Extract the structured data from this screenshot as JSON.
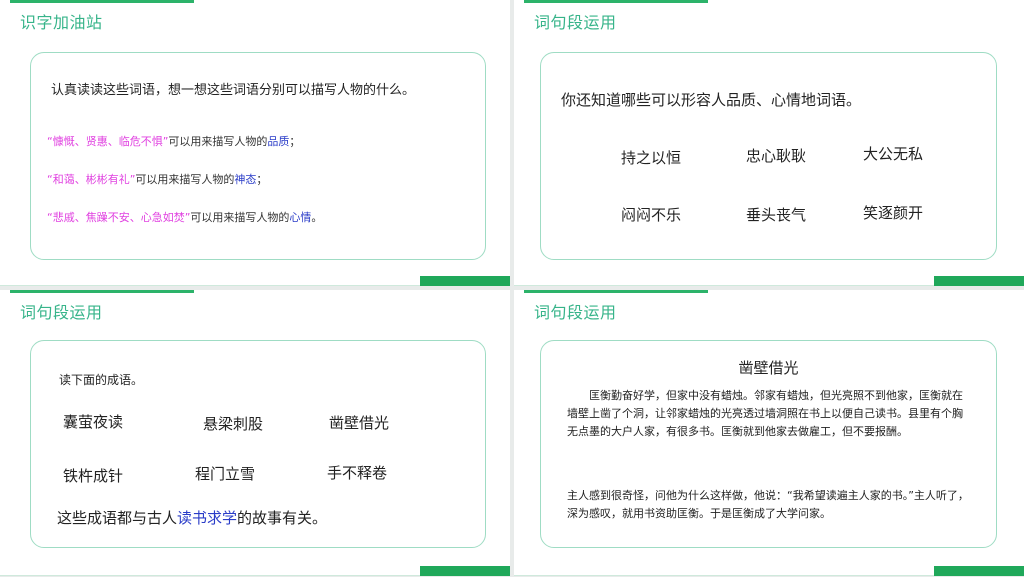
{
  "slide1": {
    "title": "识字加油站",
    "intro": "认真读读这些词语，想一想这些词语分别可以描写人物的什么。",
    "lines": [
      {
        "quote": "“慷慨、贤惠、临危不惧”",
        "mid": "可以用来描写人物的",
        "key": "品质",
        "end": "；"
      },
      {
        "quote": "“和蔼、彬彬有礼”",
        "mid": "可以用来描写人物的",
        "key": "神态",
        "end": "；"
      },
      {
        "quote": "“悲戚、焦躁不安、心急如焚”",
        "mid": "可以用来描写人物的",
        "key": "心情",
        "end": "。"
      }
    ]
  },
  "slide2": {
    "title": "词句段运用",
    "question": "你还知道哪些可以形容人品质、心情地词语。",
    "words": [
      "持之以恒",
      "忠心耿耿",
      "大公无私",
      "闷闷不乐",
      "垂头丧气",
      "笑逐颜开"
    ]
  },
  "slide3": {
    "title": "词句段运用",
    "intro": "读下面的成语。",
    "idioms": [
      "囊萤夜读",
      "悬梁刺股",
      "凿壁借光",
      "铁杵成针",
      "程门立雪",
      "手不释卷"
    ],
    "conclusion_pre": "这些成语都与古人",
    "conclusion_key": "读书求学",
    "conclusion_post": "的故事有关。"
  },
  "slide4": {
    "title": "词句段运用",
    "story_title": "凿壁借光",
    "p1": "匡衡勤奋好学，但家中没有蜡烛。邻家有蜡烛，但光亮照不到他家，匡衡就在墙壁上凿了个洞，让邻家蜡烛的光亮透过墙洞照在书上以便自己读书。县里有个胸无点墨的大户人家，有很多书。匡衡就到他家去做雇工，但不要报酬。",
    "p2": "主人感到很奇怪，问他为什么这样做，他说：“我希望读遍主人家的书。”主人听了，深为感叹，就用书资助匡衡。于是匡衡成了大学问家。"
  }
}
